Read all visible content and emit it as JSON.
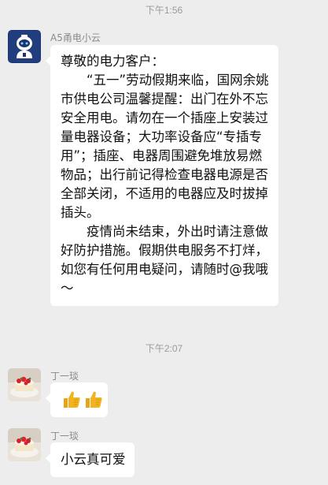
{
  "chat": {
    "timestamps": [
      "下午1:56",
      "下午2:07"
    ],
    "messages": [
      {
        "sender": "A5甬电小云",
        "avatar": "robot-avatar-icon",
        "paragraphs": [
          "尊敬的电力客户：",
          "“五一”劳动假期来临，国网余姚市供电公司温馨提醒：出门在外不忘安全用电。请勿在一个插座上安装过量电器设备；大功率设备应“专插专用”；插座、电器周围避免堆放易燃物品；出行前记得检查电器电源是否全部关闭，不适用的电器应及时拔掉插头。",
          "疫情尚未结束，外出时请注意做好防护措施。假期供电服务不打烊，如您有任何用电疑问，请随时@我哦～"
        ]
      },
      {
        "sender": "丁一琰",
        "avatar": "cake-avatar-icon",
        "content": "thumbs-up-emoji x2"
      },
      {
        "sender": "丁一琰",
        "avatar": "cake-avatar-icon",
        "text": "小云真可爱"
      }
    ]
  },
  "colors": {
    "background": "#ededed",
    "bubble": "#ffffff",
    "robot_avatar_bg": "#1b3470",
    "thumbs_up": "#f2b320"
  }
}
